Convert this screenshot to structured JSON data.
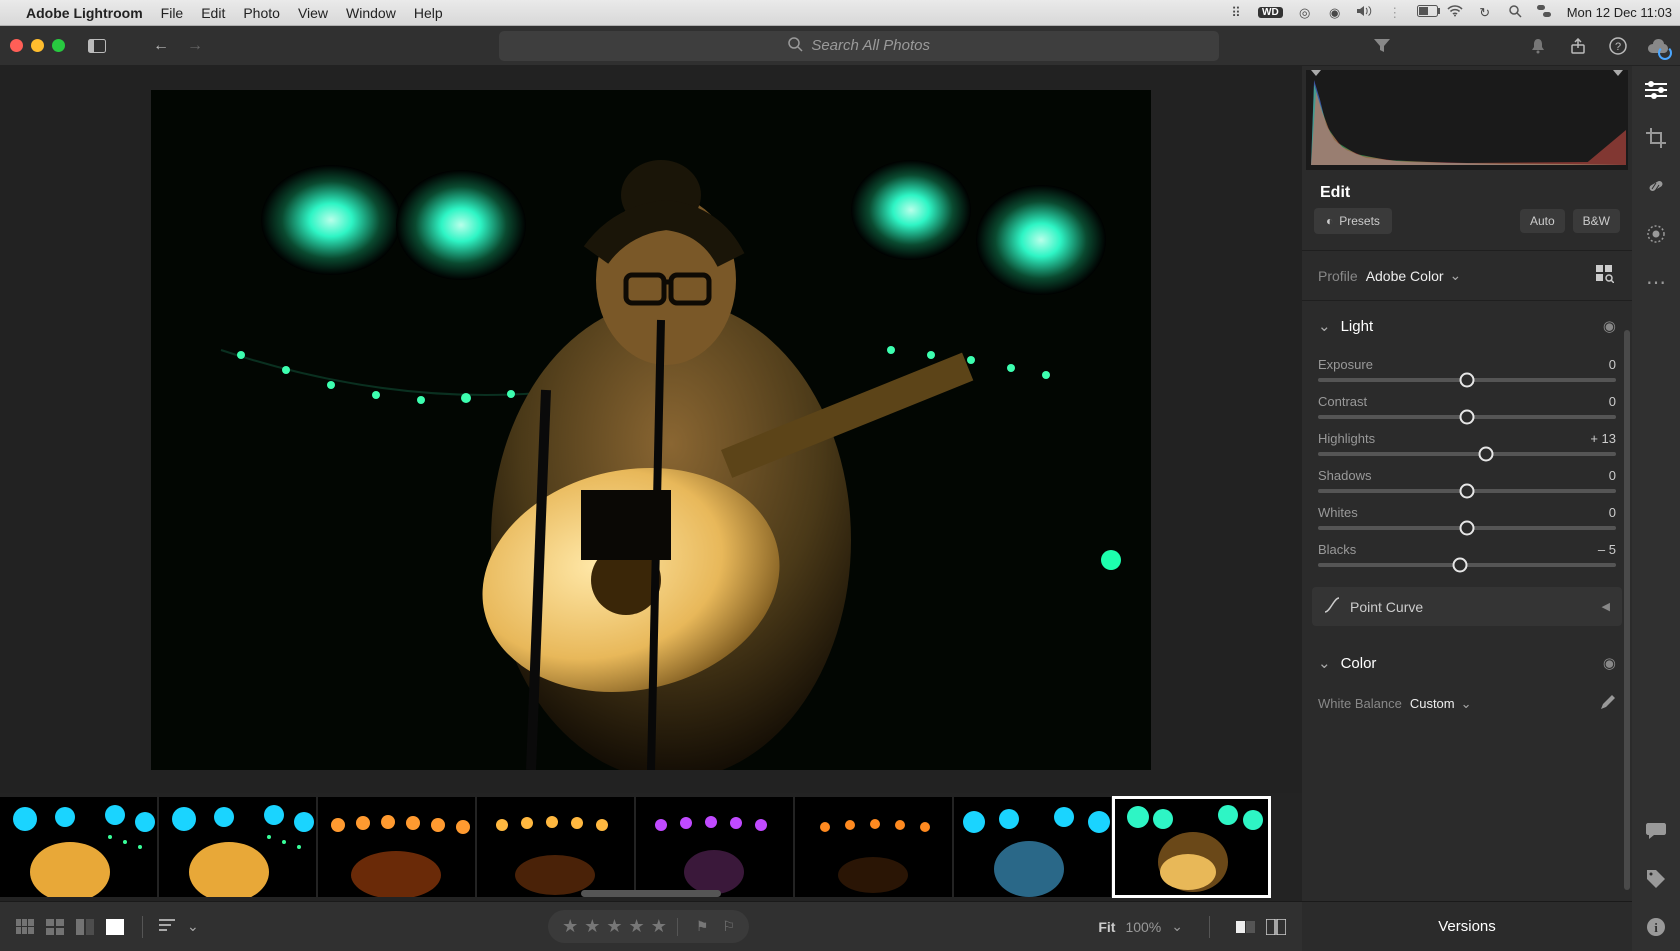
{
  "menubar": {
    "app_name": "Adobe Lightroom",
    "menus": [
      "File",
      "Edit",
      "Photo",
      "View",
      "Window",
      "Help"
    ],
    "status_icons": [
      "toolbox",
      "wd",
      "creative",
      "grammarly",
      "volume",
      "bluetooth",
      "battery",
      "wifi",
      "clock-menu",
      "search",
      "control-center"
    ],
    "wd_badge": "WD",
    "datetime": "Mon 12 Dec  11:03"
  },
  "header": {
    "search_placeholder": "Search All Photos"
  },
  "edit": {
    "title": "Edit",
    "presets_button": "Presets",
    "auto_button": "Auto",
    "bw_button": "B&W",
    "profile_label": "Profile",
    "profile_value": "Adobe Color",
    "light_label": "Light",
    "sliders": {
      "exposure": {
        "label": "Exposure",
        "value": "0",
        "pct": 50
      },
      "contrast": {
        "label": "Contrast",
        "value": "0",
        "pct": 50
      },
      "highlights": {
        "label": "Highlights",
        "value": "+ 13",
        "pct": 56.5
      },
      "shadows": {
        "label": "Shadows",
        "value": "0",
        "pct": 50
      },
      "whites": {
        "label": "Whites",
        "value": "0",
        "pct": 50
      },
      "blacks": {
        "label": "Blacks",
        "value": "– 5",
        "pct": 47.5
      }
    },
    "point_curve_label": "Point Curve",
    "color_label": "Color",
    "wb_label": "White Balance",
    "wb_value": "Custom",
    "versions_label": "Versions"
  },
  "bottom": {
    "fit_label": "Fit",
    "zoom_level": "100%"
  }
}
